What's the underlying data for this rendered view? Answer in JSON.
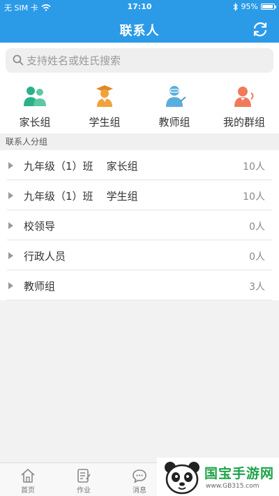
{
  "status": {
    "carrier": "无 SIM 卡",
    "time": "17:10",
    "battery": "95%",
    "battery_fraction": 0.95
  },
  "header": {
    "title": "联系人"
  },
  "search": {
    "placeholder": "支持姓名或姓氏搜索"
  },
  "groups": [
    {
      "label": "家长组",
      "icon": "parents-icon",
      "color": "#2bb18a"
    },
    {
      "label": "学生组",
      "icon": "student-icon",
      "color": "#f0a23b"
    },
    {
      "label": "教师组",
      "icon": "teacher-icon",
      "color": "#5aaedf"
    },
    {
      "label": "我的群组",
      "icon": "my-group-icon",
      "color": "#f07a5a"
    }
  ],
  "section": {
    "title": "联系人分组"
  },
  "contact_groups": [
    {
      "name": "九年级（1）班    家长组",
      "count": "10人"
    },
    {
      "name": "九年级（1）班    学生组",
      "count": "10人"
    },
    {
      "name": "校领导",
      "count": "0人"
    },
    {
      "name": "行政人员",
      "count": "0人"
    },
    {
      "name": "教师组",
      "count": "3人"
    }
  ],
  "tabs": [
    {
      "label": "首页",
      "icon": "home-icon"
    },
    {
      "label": "作业",
      "icon": "homework-icon"
    },
    {
      "label": "消息",
      "icon": "message-icon"
    }
  ],
  "watermark": {
    "text": "国宝手游网",
    "url": "www.GB315.com"
  }
}
